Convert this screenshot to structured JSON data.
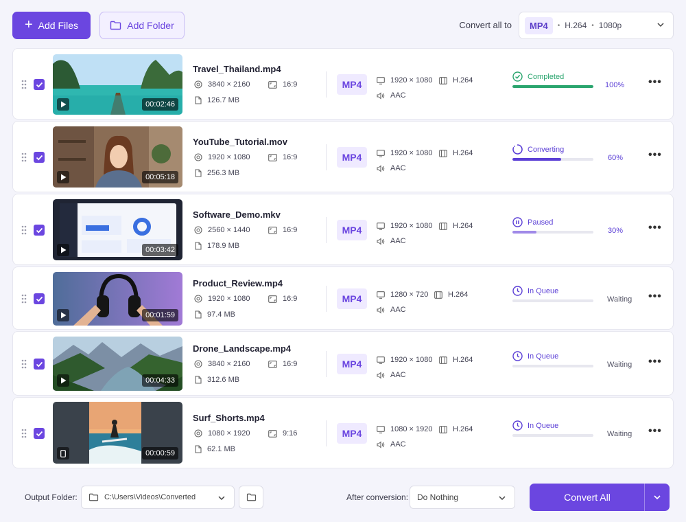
{
  "toolbar": {
    "add_files_label": "Add Files",
    "add_folder_label": "Add Folder",
    "convert_all_label": "Convert all to",
    "format": "MP4",
    "codec": "H.264",
    "resolution": "1080p"
  },
  "colors": {
    "accent": "#6b46e0",
    "completed": "#2aa56e",
    "converting": "#5b3fd6",
    "paused": "#a08ae8"
  },
  "files": [
    {
      "name": "Travel_Thailand.mp4",
      "duration": "00:02:46",
      "resolution": "3840 × 2160",
      "aspect": "16:9",
      "size": "126.7 MB",
      "out_format": "MP4",
      "out_resolution": "1920 × 1080",
      "out_codec": "H.264",
      "audio": "AAC",
      "status": "Completed",
      "status_icon": "check-circle-icon",
      "progress": 100,
      "progress_text": "100%"
    },
    {
      "name": "YouTube_Tutorial.mov",
      "duration": "00:05:18",
      "resolution": "1920 × 1080",
      "aspect": "16:9",
      "size": "256.3 MB",
      "out_format": "MP4",
      "out_resolution": "1920 × 1080",
      "out_codec": "H.264",
      "audio": "AAC",
      "status": "Converting",
      "status_icon": "spinner-icon",
      "progress": 60,
      "progress_text": "60%"
    },
    {
      "name": "Software_Demo.mkv",
      "duration": "00:03:42",
      "resolution": "2560 × 1440",
      "aspect": "16:9",
      "size": "178.9 MB",
      "out_format": "MP4",
      "out_resolution": "1920 × 1080",
      "out_codec": "H.264",
      "audio": "AAC",
      "status": "Paused",
      "status_icon": "pause-circle-icon",
      "progress": 30,
      "progress_text": "30%"
    },
    {
      "name": "Product_Review.mp4",
      "duration": "00:01:59",
      "resolution": "1920 × 1080",
      "aspect": "16:9",
      "size": "97.4 MB",
      "out_format": "MP4",
      "out_resolution": "1280 × 720",
      "out_codec": "H.264",
      "audio": "AAC",
      "status": "In Queue",
      "status_icon": "clock-icon",
      "progress": 0,
      "progress_text": "Waiting"
    },
    {
      "name": "Drone_Landscape.mp4",
      "duration": "00:04:33",
      "resolution": "3840 × 2160",
      "aspect": "16:9",
      "size": "312.6 MB",
      "out_format": "MP4",
      "out_resolution": "1920 × 1080",
      "out_codec": "H.264",
      "audio": "AAC",
      "status": "In Queue",
      "status_icon": "clock-icon",
      "progress": 0,
      "progress_text": "Waiting"
    },
    {
      "name": "Surf_Shorts.mp4",
      "duration": "00:00:59",
      "resolution": "1080 × 1920",
      "aspect": "9:16",
      "size": "62.1 MB",
      "out_format": "MP4",
      "out_resolution": "1080 × 1920",
      "out_codec": "H.264",
      "audio": "AAC",
      "status": "In Queue",
      "status_icon": "clock-icon",
      "progress": 0,
      "progress_text": "Waiting"
    }
  ],
  "footer": {
    "output_folder_label": "Output Folder:",
    "output_path": "C:\\Users\\Videos\\Converted",
    "after_conversion_label": "After conversion:",
    "after_conversion_value": "Do Nothing",
    "convert_all_button": "Convert All"
  }
}
